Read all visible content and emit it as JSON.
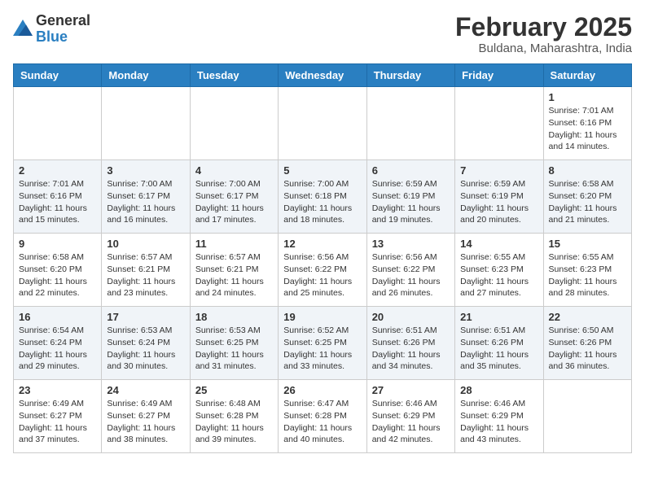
{
  "header": {
    "logo_line1": "General",
    "logo_line2": "Blue",
    "month": "February 2025",
    "location": "Buldana, Maharashtra, India"
  },
  "weekdays": [
    "Sunday",
    "Monday",
    "Tuesday",
    "Wednesday",
    "Thursday",
    "Friday",
    "Saturday"
  ],
  "weeks": [
    [
      {
        "day": "",
        "info": ""
      },
      {
        "day": "",
        "info": ""
      },
      {
        "day": "",
        "info": ""
      },
      {
        "day": "",
        "info": ""
      },
      {
        "day": "",
        "info": ""
      },
      {
        "day": "",
        "info": ""
      },
      {
        "day": "1",
        "info": "Sunrise: 7:01 AM\nSunset: 6:16 PM\nDaylight: 11 hours\nand 14 minutes."
      }
    ],
    [
      {
        "day": "2",
        "info": "Sunrise: 7:01 AM\nSunset: 6:16 PM\nDaylight: 11 hours\nand 15 minutes."
      },
      {
        "day": "3",
        "info": "Sunrise: 7:00 AM\nSunset: 6:17 PM\nDaylight: 11 hours\nand 16 minutes."
      },
      {
        "day": "4",
        "info": "Sunrise: 7:00 AM\nSunset: 6:17 PM\nDaylight: 11 hours\nand 17 minutes."
      },
      {
        "day": "5",
        "info": "Sunrise: 7:00 AM\nSunset: 6:18 PM\nDaylight: 11 hours\nand 18 minutes."
      },
      {
        "day": "6",
        "info": "Sunrise: 6:59 AM\nSunset: 6:19 PM\nDaylight: 11 hours\nand 19 minutes."
      },
      {
        "day": "7",
        "info": "Sunrise: 6:59 AM\nSunset: 6:19 PM\nDaylight: 11 hours\nand 20 minutes."
      },
      {
        "day": "8",
        "info": "Sunrise: 6:58 AM\nSunset: 6:20 PM\nDaylight: 11 hours\nand 21 minutes."
      }
    ],
    [
      {
        "day": "9",
        "info": "Sunrise: 6:58 AM\nSunset: 6:20 PM\nDaylight: 11 hours\nand 22 minutes."
      },
      {
        "day": "10",
        "info": "Sunrise: 6:57 AM\nSunset: 6:21 PM\nDaylight: 11 hours\nand 23 minutes."
      },
      {
        "day": "11",
        "info": "Sunrise: 6:57 AM\nSunset: 6:21 PM\nDaylight: 11 hours\nand 24 minutes."
      },
      {
        "day": "12",
        "info": "Sunrise: 6:56 AM\nSunset: 6:22 PM\nDaylight: 11 hours\nand 25 minutes."
      },
      {
        "day": "13",
        "info": "Sunrise: 6:56 AM\nSunset: 6:22 PM\nDaylight: 11 hours\nand 26 minutes."
      },
      {
        "day": "14",
        "info": "Sunrise: 6:55 AM\nSunset: 6:23 PM\nDaylight: 11 hours\nand 27 minutes."
      },
      {
        "day": "15",
        "info": "Sunrise: 6:55 AM\nSunset: 6:23 PM\nDaylight: 11 hours\nand 28 minutes."
      }
    ],
    [
      {
        "day": "16",
        "info": "Sunrise: 6:54 AM\nSunset: 6:24 PM\nDaylight: 11 hours\nand 29 minutes."
      },
      {
        "day": "17",
        "info": "Sunrise: 6:53 AM\nSunset: 6:24 PM\nDaylight: 11 hours\nand 30 minutes."
      },
      {
        "day": "18",
        "info": "Sunrise: 6:53 AM\nSunset: 6:25 PM\nDaylight: 11 hours\nand 31 minutes."
      },
      {
        "day": "19",
        "info": "Sunrise: 6:52 AM\nSunset: 6:25 PM\nDaylight: 11 hours\nand 33 minutes."
      },
      {
        "day": "20",
        "info": "Sunrise: 6:51 AM\nSunset: 6:26 PM\nDaylight: 11 hours\nand 34 minutes."
      },
      {
        "day": "21",
        "info": "Sunrise: 6:51 AM\nSunset: 6:26 PM\nDaylight: 11 hours\nand 35 minutes."
      },
      {
        "day": "22",
        "info": "Sunrise: 6:50 AM\nSunset: 6:26 PM\nDaylight: 11 hours\nand 36 minutes."
      }
    ],
    [
      {
        "day": "23",
        "info": "Sunrise: 6:49 AM\nSunset: 6:27 PM\nDaylight: 11 hours\nand 37 minutes."
      },
      {
        "day": "24",
        "info": "Sunrise: 6:49 AM\nSunset: 6:27 PM\nDaylight: 11 hours\nand 38 minutes."
      },
      {
        "day": "25",
        "info": "Sunrise: 6:48 AM\nSunset: 6:28 PM\nDaylight: 11 hours\nand 39 minutes."
      },
      {
        "day": "26",
        "info": "Sunrise: 6:47 AM\nSunset: 6:28 PM\nDaylight: 11 hours\nand 40 minutes."
      },
      {
        "day": "27",
        "info": "Sunrise: 6:46 AM\nSunset: 6:29 PM\nDaylight: 11 hours\nand 42 minutes."
      },
      {
        "day": "28",
        "info": "Sunrise: 6:46 AM\nSunset: 6:29 PM\nDaylight: 11 hours\nand 43 minutes."
      },
      {
        "day": "",
        "info": ""
      }
    ]
  ]
}
